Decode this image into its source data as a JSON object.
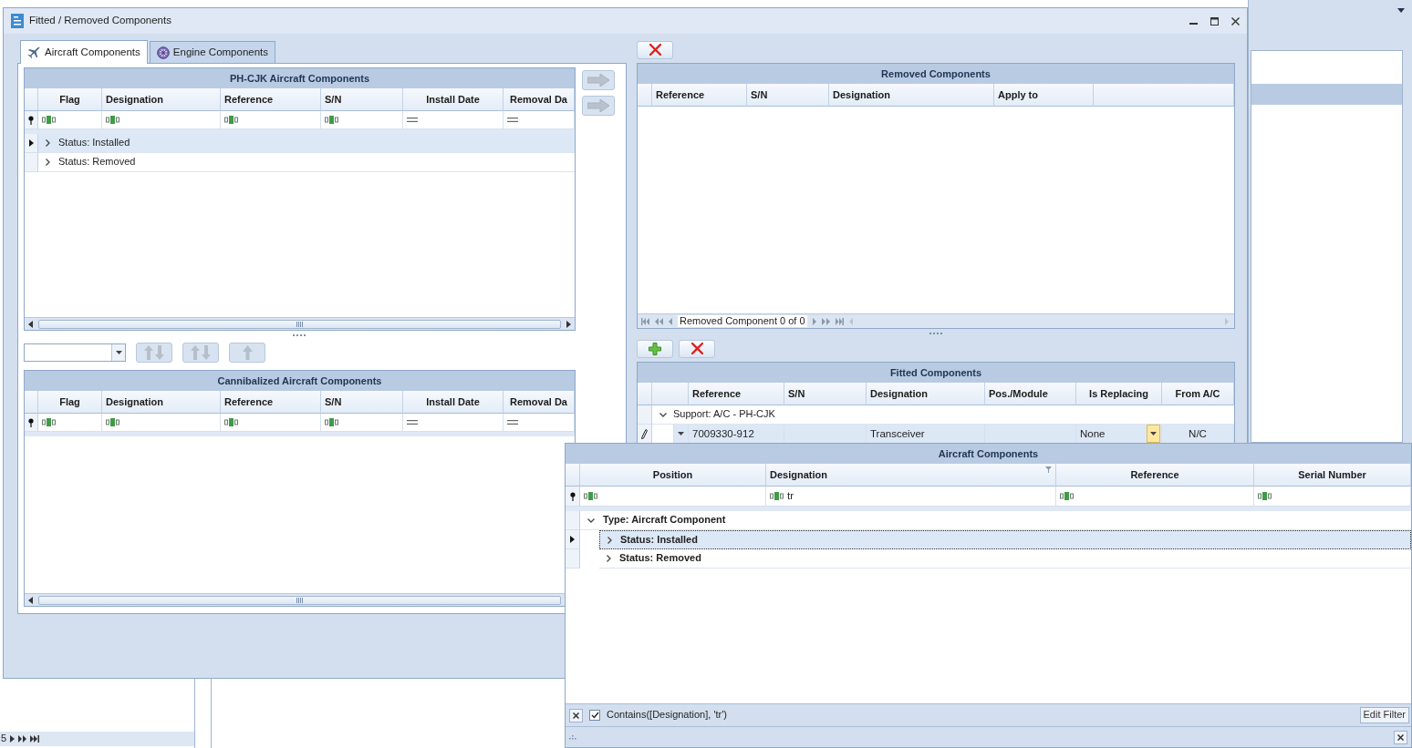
{
  "window": {
    "title": "Fitted / Removed Components"
  },
  "tabs": [
    {
      "label": "Aircraft Components",
      "selected": true,
      "kind": "aircraft"
    },
    {
      "label": "Engine Components",
      "selected": false,
      "kind": "engine"
    }
  ],
  "aircraft_grid": {
    "title": "PH-CJK Aircraft Components",
    "columns": [
      {
        "label": "Flag",
        "kind": "text"
      },
      {
        "label": "Designation",
        "kind": "text"
      },
      {
        "label": "Reference",
        "kind": "text"
      },
      {
        "label": "S/N",
        "kind": "text"
      },
      {
        "label": "Install Date",
        "kind": "date"
      },
      {
        "label": "Removal Da",
        "kind": "date"
      }
    ],
    "groups": [
      {
        "label": "Status: Installed",
        "expanded": false,
        "selected": true
      },
      {
        "label": "Status: Removed",
        "expanded": false,
        "selected": false
      }
    ]
  },
  "move_buttons": [
    {
      "disabled": true
    },
    {
      "disabled": true
    }
  ],
  "order_buttons": [
    {
      "kind": "swap",
      "disabled": true
    },
    {
      "kind": "swap",
      "disabled": true
    },
    {
      "kind": "up",
      "disabled": true
    }
  ],
  "cannibalized_grid": {
    "title": "Cannibalized Aircraft Components",
    "columns": [
      {
        "label": "Flag",
        "kind": "text"
      },
      {
        "label": "Designation",
        "kind": "text"
      },
      {
        "label": "Reference",
        "kind": "text"
      },
      {
        "label": "S/N",
        "kind": "text"
      },
      {
        "label": "Install Date",
        "kind": "date"
      },
      {
        "label": "Removal Da",
        "kind": "date"
      }
    ]
  },
  "removed_grid": {
    "title": "Removed Components",
    "columns": [
      {
        "label": "Reference"
      },
      {
        "label": "S/N"
      },
      {
        "label": "Designation"
      },
      {
        "label": "Apply to"
      }
    ],
    "navigator": "Removed Component 0 of 0"
  },
  "fitted_grid": {
    "title": "Fitted Components",
    "columns": [
      {
        "label": "Reference"
      },
      {
        "label": "S/N"
      },
      {
        "label": "Designation"
      },
      {
        "label": "Pos./Module"
      },
      {
        "label": "Is Replacing"
      },
      {
        "label": "From A/C"
      }
    ],
    "groups": [
      {
        "label": "Support: A/C - PH-CJK",
        "expanded": true,
        "rows": [
          {
            "editing": true,
            "cells": [
              "7009330-912",
              null,
              "Transceiver",
              null,
              "None",
              "N/C"
            ]
          }
        ]
      }
    ]
  },
  "lookup_popup": {
    "title": "Aircraft Components",
    "columns": [
      {
        "label": "Position",
        "filtered": false
      },
      {
        "label": "Designation",
        "filtered": true,
        "filter_value": "tr"
      },
      {
        "label": "Reference",
        "filtered": false
      },
      {
        "label": "Serial Number",
        "filtered": false
      }
    ],
    "groups": [
      {
        "label": "Type: Aircraft Component",
        "expanded": true,
        "selected": false,
        "children": [
          {
            "label": "Status: Installed",
            "expanded": false,
            "selected": true
          },
          {
            "label": "Status: Removed",
            "expanded": false,
            "selected": false
          }
        ]
      }
    ],
    "filter_bar": {
      "enabled": true,
      "expression": "Contains([Designation], 'tr')",
      "edit_label": "Edit Filter"
    }
  },
  "background": {
    "pager_text": "5"
  }
}
